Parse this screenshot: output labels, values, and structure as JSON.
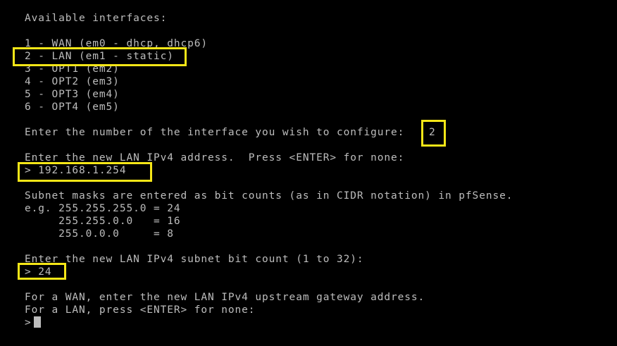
{
  "terminal": {
    "header": "Available interfaces:",
    "interfaces": [
      "1 - WAN (em0 - dhcp, dhcp6)",
      "2 - LAN (em1 - static)",
      "3 - OPT1 (em2)",
      "4 - OPT2 (em3)",
      "5 - OPT3 (em4)",
      "6 - OPT4 (em5)"
    ],
    "interface_prompt": "Enter the number of the interface you wish to configure:",
    "interface_answer": "2",
    "ip_prompt": "Enter the new LAN IPv4 address.  Press <ENTER> for none:",
    "ip_answer": "> 192.168.1.254",
    "subnet_info_1": "Subnet masks are entered as bit counts (as in CIDR notation) in pfSense.",
    "subnet_info_2": "e.g. 255.255.255.0 = 24",
    "subnet_info_3": "     255.255.0.0   = 16",
    "subnet_info_4": "     255.0.0.0     = 8",
    "bitcount_prompt": "Enter the new LAN IPv4 subnet bit count (1 to 32):",
    "bitcount_answer": "> 24",
    "gateway_prompt_1": "For a WAN, enter the new LAN IPv4 upstream gateway address.",
    "gateway_prompt_2": "For a LAN, press <ENTER> for none:",
    "input_prompt": ">"
  },
  "colors": {
    "background": "#000000",
    "text": "#bdbdbd",
    "highlight": "#f5e617"
  }
}
